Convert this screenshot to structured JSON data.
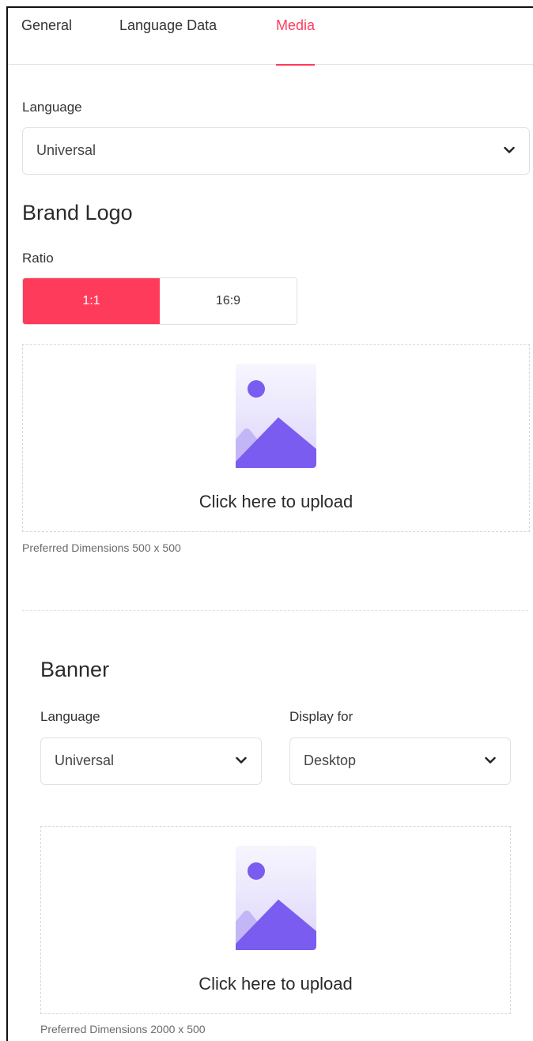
{
  "tabs": [
    {
      "label": "General"
    },
    {
      "label": "Language Data"
    },
    {
      "label": "Media"
    }
  ],
  "active_tab": "Media",
  "accent_color": "#ff3b5c",
  "illustration_color": "#7b5cf0",
  "media": {
    "language_label": "Language",
    "language_value": "Universal",
    "brand_logo": {
      "title": "Brand Logo",
      "ratio_label": "Ratio",
      "ratio_options": [
        "1:1",
        "16:9"
      ],
      "ratio_selected": "1:1",
      "upload_text": "Click here to upload",
      "hint": "Preferred Dimensions 500 x 500"
    },
    "banner": {
      "title": "Banner",
      "language_label": "Language",
      "language_value": "Universal",
      "display_label": "Display for",
      "display_value": "Desktop",
      "upload_text": "Click here to upload",
      "hint": "Preferred Dimensions 2000 x 500"
    }
  },
  "icons": {
    "dropdown": "chevron-down-icon",
    "upload": "image-placeholder-icon"
  }
}
